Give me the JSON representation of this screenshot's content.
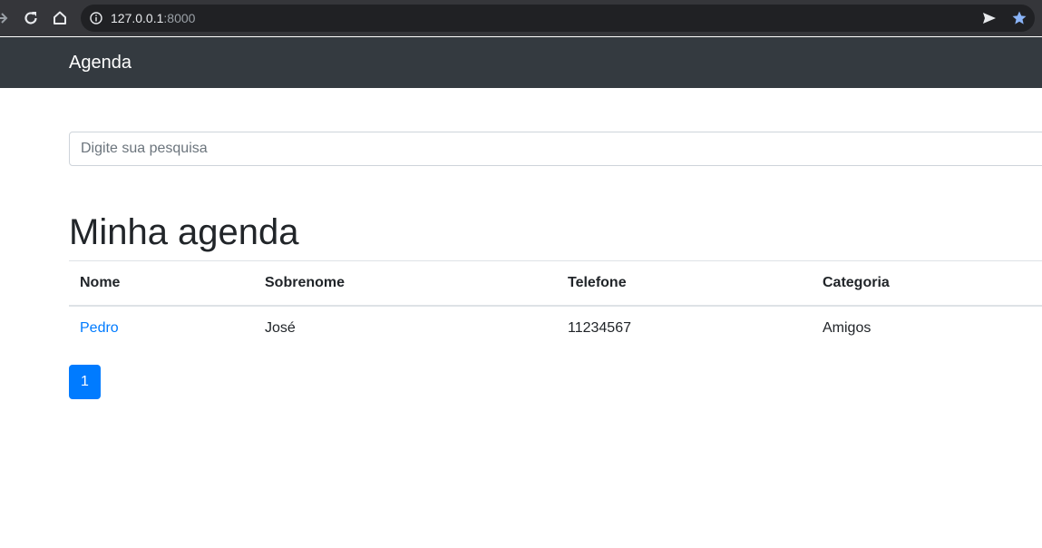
{
  "browser": {
    "url_host": "127.0.0.1",
    "url_port": ":8000"
  },
  "navbar": {
    "brand": "Agenda"
  },
  "search": {
    "placeholder": "Digite sua pesquisa",
    "value": ""
  },
  "main": {
    "title": "Minha agenda",
    "table": {
      "headers": [
        "Nome",
        "Sobrenome",
        "Telefone",
        "Categoria"
      ],
      "rows": [
        [
          "Pedro",
          "José",
          "11234567",
          "Amigos"
        ]
      ]
    },
    "pagination": {
      "current_page": "1"
    }
  },
  "colors": {
    "navbar_bg": "#343a40",
    "primary": "#007bff",
    "browser_star": "#8ab4f8"
  },
  "icons": [
    "back-arrow-icon",
    "reload-icon",
    "home-icon",
    "info-icon",
    "send-icon",
    "star-icon"
  ]
}
